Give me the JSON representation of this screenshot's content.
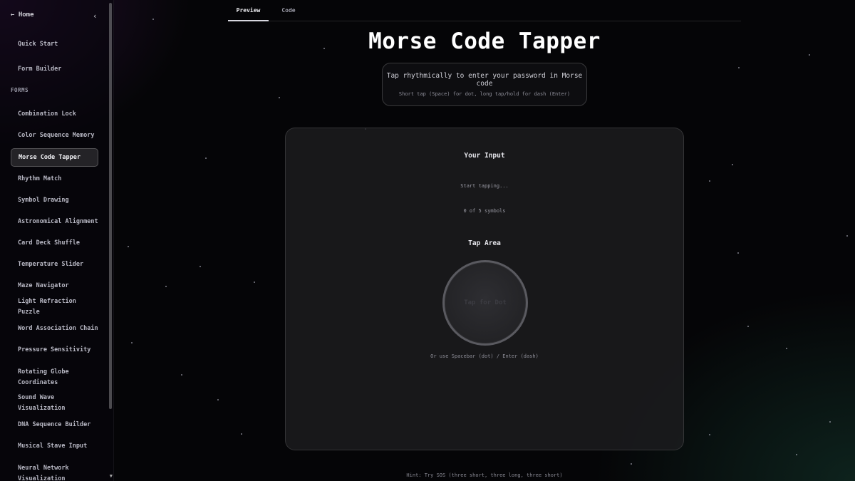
{
  "sidebar": {
    "home_label": "← Home",
    "collapse_icon": "‹",
    "section_label": "FORMS",
    "top_items": [
      {
        "label": "Quick Start"
      },
      {
        "label": "Form Builder"
      }
    ],
    "items": [
      {
        "label": "Combination Lock"
      },
      {
        "label": "Color Sequence Memory"
      },
      {
        "label": "Morse Code Tapper",
        "active": true
      },
      {
        "label": "Rhythm Match"
      },
      {
        "label": "Symbol Drawing"
      },
      {
        "label": "Astronomical Alignment"
      },
      {
        "label": "Card Deck Shuffle"
      },
      {
        "label": "Temperature Slider"
      },
      {
        "label": "Maze Navigator"
      },
      {
        "label": "Light Refraction Puzzle"
      },
      {
        "label": "Word Association Chain"
      },
      {
        "label": "Pressure Sensitivity"
      },
      {
        "label": "Rotating Globe Coordinates"
      },
      {
        "label": "Sound Wave Visualization"
      },
      {
        "label": "DNA Sequence Builder"
      },
      {
        "label": "Musical Stave Input"
      },
      {
        "label": "Neural Network Visualization"
      }
    ]
  },
  "tabs": [
    {
      "label": "Preview",
      "active": true
    },
    {
      "label": "Code",
      "active": false
    }
  ],
  "main": {
    "title": "Morse Code Tapper",
    "instruction": "Tap rhythmically to enter your password in Morse code",
    "instruction_sub": "Short tap (Space) for dot, long tap/hold for dash (Enter)",
    "input_label": "Your Input",
    "input_value": "Start tapping...",
    "symbol_count": "0 of 5 symbols",
    "tap_label": "Tap Area",
    "tap_button_text": "Tap for Dot",
    "key_hint": "Or use Spacebar (dot) / Enter (dash)",
    "bottom_hint": "Hint: Try SOS (three short, three long, three short)"
  },
  "colors": {
    "background": "#050507",
    "panel": "#1e1e20",
    "accent_text": "#ffffff"
  }
}
